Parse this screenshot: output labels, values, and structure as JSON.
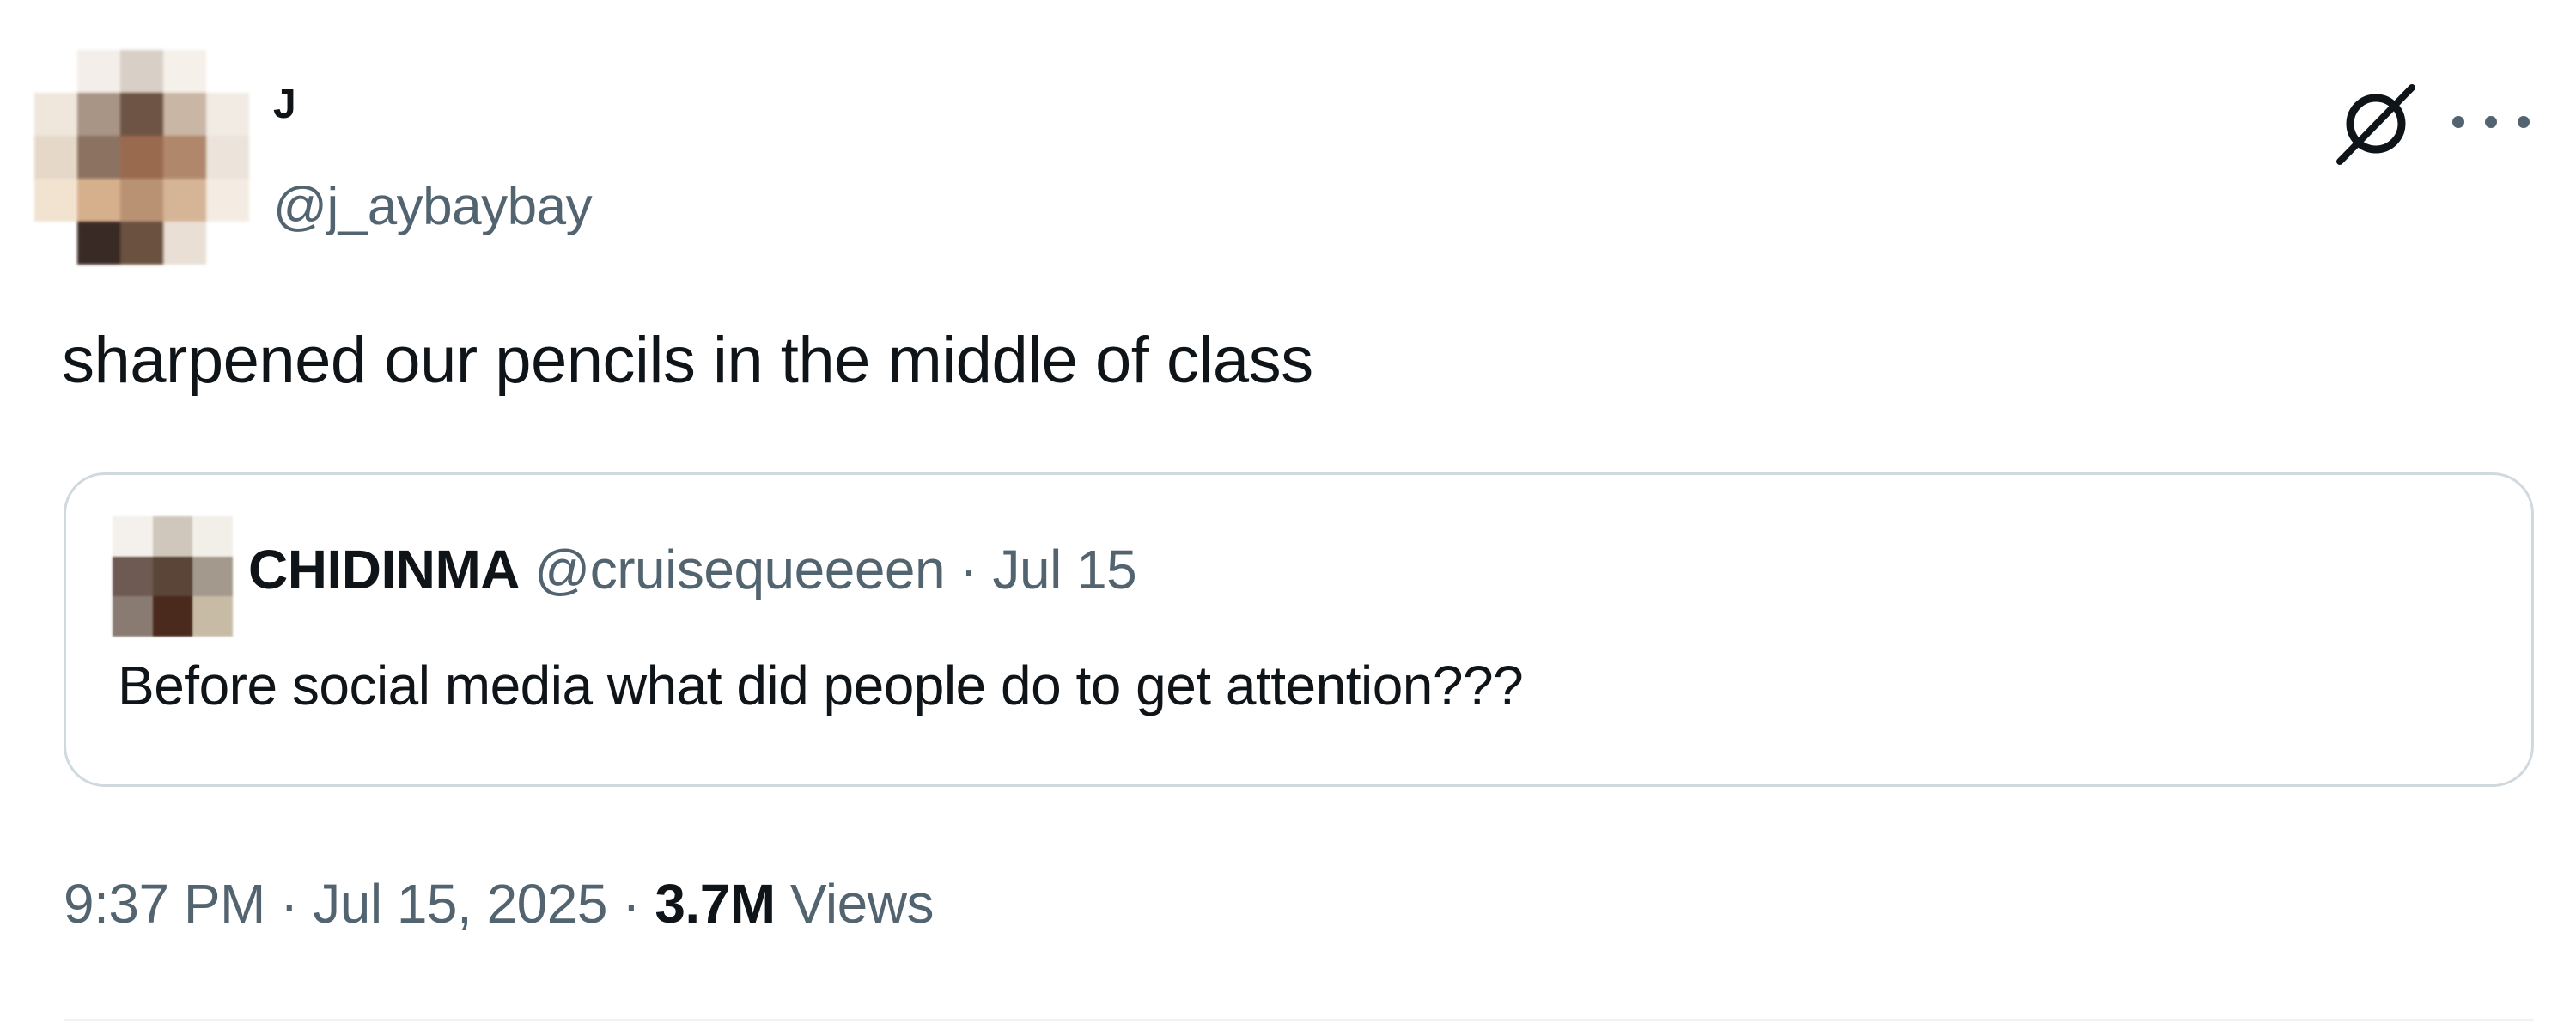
{
  "tweet": {
    "author": {
      "display_name": "J",
      "handle": "@j_aybaybay"
    },
    "text": "sharpened our pencils in the middle of class",
    "quote": {
      "author": {
        "display_name": "CHIDINMA",
        "handle": "@cruisequeeeen"
      },
      "separator": "·",
      "date": "Jul 15",
      "text": "Before social media what did people do to get attention???"
    },
    "meta": {
      "time": "9:37 PM",
      "separator": "·",
      "date": "Jul 15, 2025",
      "views_count": "3.7M",
      "views_label": "Views"
    }
  },
  "icons": {
    "grok": "grok-icon",
    "more": "more-options-icon",
    "avatar": "blurred-avatar",
    "quote_avatar": "blurred-avatar"
  },
  "colors": {
    "text_primary": "#0f1419",
    "text_secondary": "#536471",
    "border": "#cfd9de",
    "background": "#ffffff"
  }
}
